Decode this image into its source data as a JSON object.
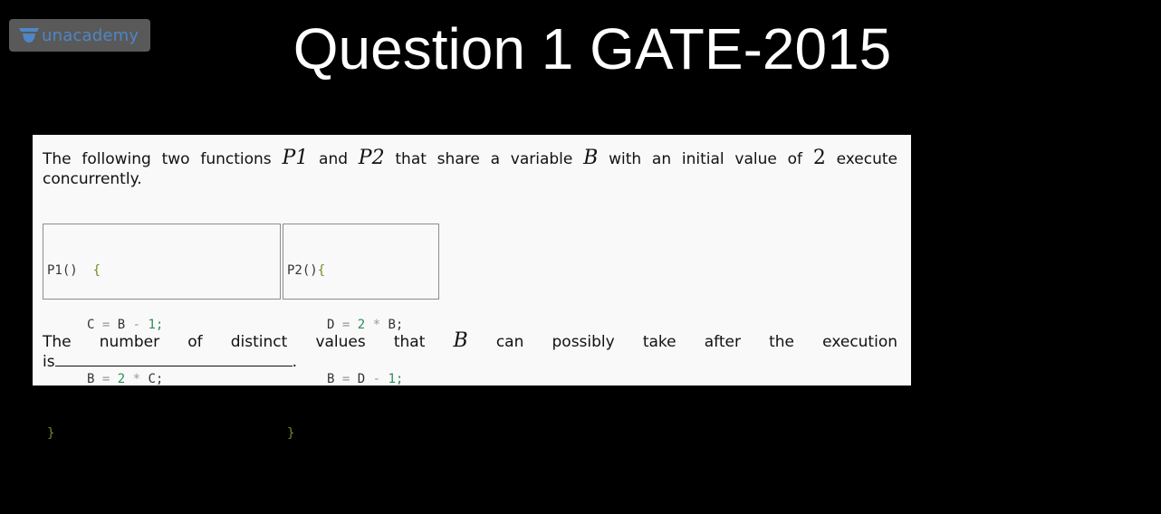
{
  "brand": {
    "name": "unacademy",
    "color": "#4f86c6"
  },
  "title": "Question 1 GATE-2015",
  "question": {
    "intro": {
      "t1": "The following two functions ",
      "v1": "P1",
      "t2": " and ",
      "v2": "P2",
      "t3": " that share a variable ",
      "v3": "B",
      "t4": " with an initial value of ",
      "v4": "2",
      "t5": " execute",
      "line2": "concurrently."
    },
    "code_p1": {
      "header_name": "P1()",
      "header_brace": "{",
      "l1_var": "C",
      "l1_eq": "=",
      "l1_a": "B",
      "l1_op": "-",
      "l1_b": "1;",
      "l2_var": "B",
      "l2_eq": "=",
      "l2_a": "2",
      "l2_op": "*",
      "l2_b": "C;",
      "close": "}"
    },
    "code_p2": {
      "header_name": "P2()",
      "header_brace": "{",
      "l1_var": "D",
      "l1_eq": "=",
      "l1_a": "2",
      "l1_op": "*",
      "l1_b": "B;",
      "l2_var": "B",
      "l2_eq": "=",
      "l2_a": "D",
      "l2_op": "-",
      "l2_b": "1;",
      "close": "}"
    },
    "ask": {
      "t1": "The number of distinct values that ",
      "v1": "B",
      "t2": " can possibly take after the execution",
      "line2_prefix": "is",
      "line2_suffix": "."
    }
  }
}
